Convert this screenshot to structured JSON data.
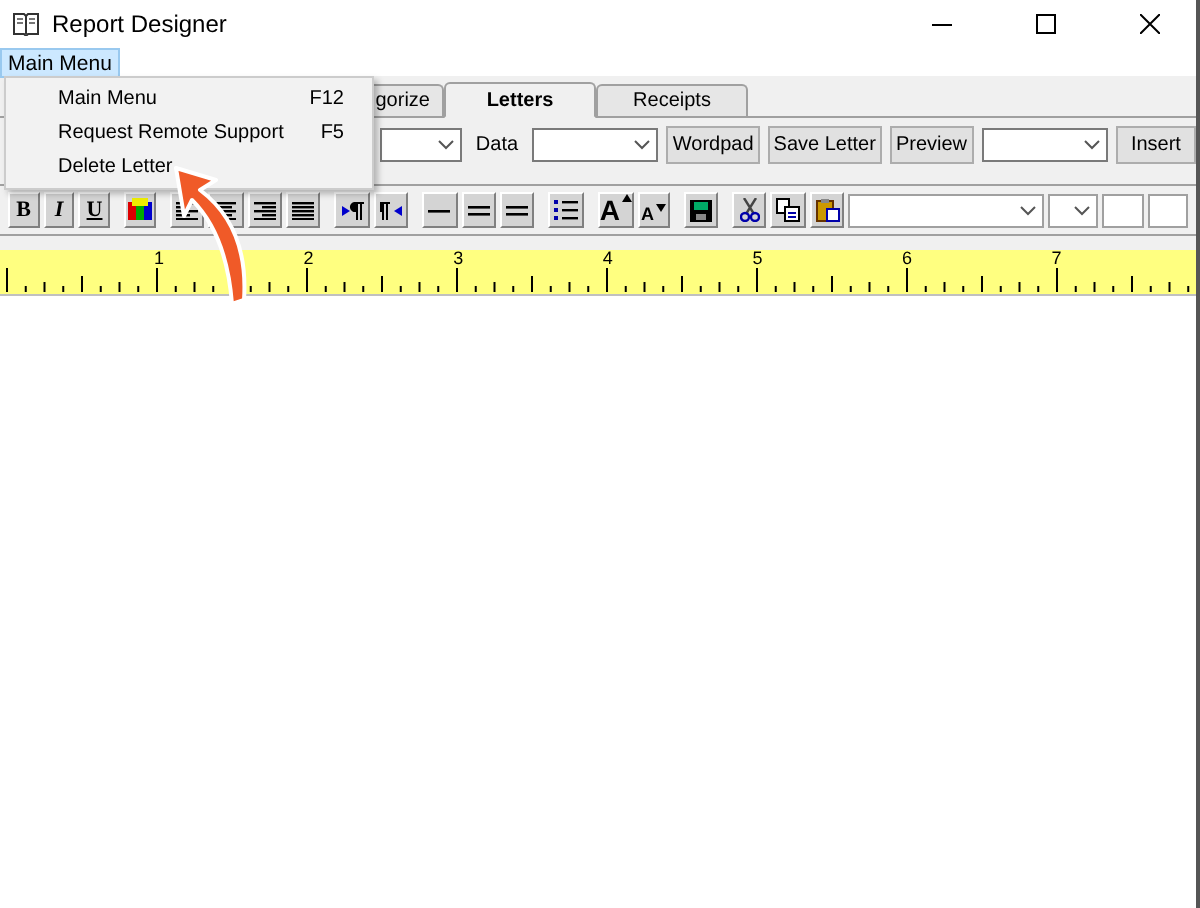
{
  "window": {
    "title": "Report Designer"
  },
  "menu_bar": [
    {
      "label": "Main Menu",
      "selected": true
    }
  ],
  "menu": {
    "items": [
      {
        "label": "Main Menu",
        "shortcut": "F12"
      },
      {
        "label": "Request Remote Support",
        "shortcut": "F5"
      },
      {
        "label": "Delete Letter"
      }
    ]
  },
  "tabs": [
    {
      "label": "gorize",
      "selected": false
    },
    {
      "label": "Letters",
      "selected": true
    },
    {
      "label": "Receipts",
      "selected": false
    }
  ],
  "toolbar": [
    {
      "kind": "dropdown"
    },
    {
      "kind": "label",
      "label": "Data"
    },
    {
      "kind": "dropdown",
      "wide": true
    },
    {
      "kind": "button",
      "label": "Wordpad"
    },
    {
      "kind": "button",
      "label": "Save Letter"
    },
    {
      "kind": "button",
      "label": "Preview"
    },
    {
      "kind": "dropdown",
      "wide": true
    },
    {
      "kind": "button",
      "label": "Insert"
    }
  ],
  "format_toolbar": [
    {
      "kind": "text",
      "label": "B"
    },
    {
      "kind": "text",
      "label": "I"
    },
    {
      "kind": "text",
      "label": "U"
    },
    {
      "kind": "colors"
    },
    {
      "kind": "align-left"
    },
    {
      "kind": "align-center"
    },
    {
      "kind": "align-right"
    },
    {
      "kind": "justify"
    },
    {
      "kind": "ltr"
    },
    {
      "kind": "rtl"
    },
    {
      "kind": "line-single"
    },
    {
      "kind": "line-double"
    },
    {
      "kind": "line-double"
    },
    {
      "kind": "bullets"
    },
    {
      "kind": "grow",
      "label": "A"
    },
    {
      "kind": "shrink",
      "label": "A"
    },
    {
      "kind": "save"
    },
    {
      "kind": "cut"
    },
    {
      "kind": "copy"
    },
    {
      "kind": "paste"
    },
    {
      "kind": "font-dropdown"
    },
    {
      "kind": "size-dropdown"
    },
    {
      "kind": "box"
    },
    {
      "kind": "box"
    }
  ],
  "ruler": {
    "numbers": [
      "1",
      "2",
      "3",
      "4",
      "5",
      "6",
      "7"
    ]
  }
}
